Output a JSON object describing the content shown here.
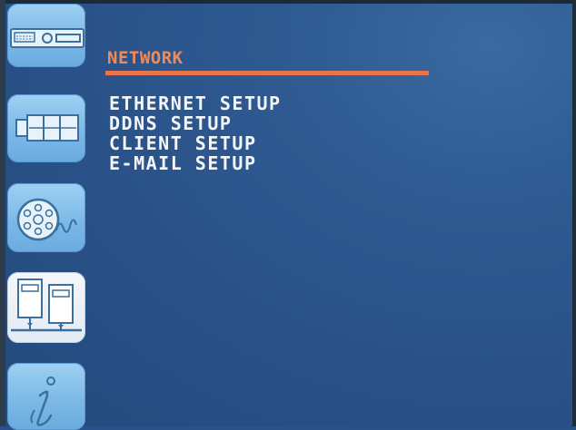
{
  "screen": {
    "title": "NETWORK",
    "menu_items": [
      {
        "label": "ETHERNET SETUP"
      },
      {
        "label": "DDNS SETUP"
      },
      {
        "label": "CLIENT SETUP"
      },
      {
        "label": "E-MAIL SETUP"
      }
    ],
    "active_section": "network"
  },
  "sidebar": {
    "items": [
      {
        "icon": "dvr-recorder-icon"
      },
      {
        "icon": "camera-icon"
      },
      {
        "icon": "disk-reel-icon"
      },
      {
        "icon": "network-computers-icon",
        "active": true
      },
      {
        "icon": "info-icon"
      }
    ]
  },
  "colors": {
    "background": "#2a528a",
    "title": "#f08a5a",
    "underline": "#e97449",
    "menu_text": "#f3f6fb",
    "tile": "#7ab7e6",
    "tile_active": "#eef3f8"
  }
}
